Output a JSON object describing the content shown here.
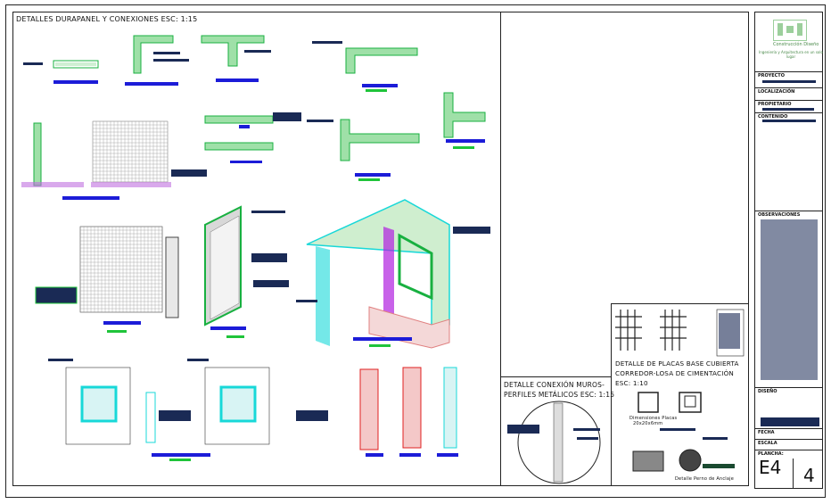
{
  "title_main": "DETALLES DURAPANEL Y CONEXIONES ESC: 1:15",
  "title_conexion_1": "DETALLE CONEXIÓN MUROS-",
  "title_conexion_2": "PERFILES METÁLICOS ESC: 1:15",
  "title_placas_1": "DETALLE DE PLACAS BASE CUBIERTA",
  "title_placas_2": "CORREDOR-LOSA DE CIMENTACIÓN",
  "title_placas_3": "ESC: 1:10",
  "dim_placas": "Dimensiones Placas",
  "dim_placas_2": "20x20x6mm",
  "detalle_perno": "Detalle Perno de Anclaje",
  "logo_text": "Construcción Diseño",
  "logo_tagline": "Ingeniería y Arquitectura en un solo lugar",
  "tb_proyecto": "PROYECTO",
  "tb_localizacion": "LOCALIZACIÓN",
  "tb_propietario": "PROPIETARIO",
  "tb_contenido": "CONTENIDO",
  "tb_observaciones": "OBSERVACIONES",
  "tb_diseno": "DISEÑO",
  "tb_fecha": "FECHA",
  "tb_escala": "ESCALA",
  "tb_plancha": "PLANCHA:",
  "sheet_code": "E4",
  "sheet_number": "4",
  "colors": {
    "accent_blue": "#1c1cd8",
    "accent_green": "#1fc43a",
    "accent_cyan": "#18d8d8",
    "accent_red": "#e02020",
    "accent_magenta": "#b020e0"
  }
}
